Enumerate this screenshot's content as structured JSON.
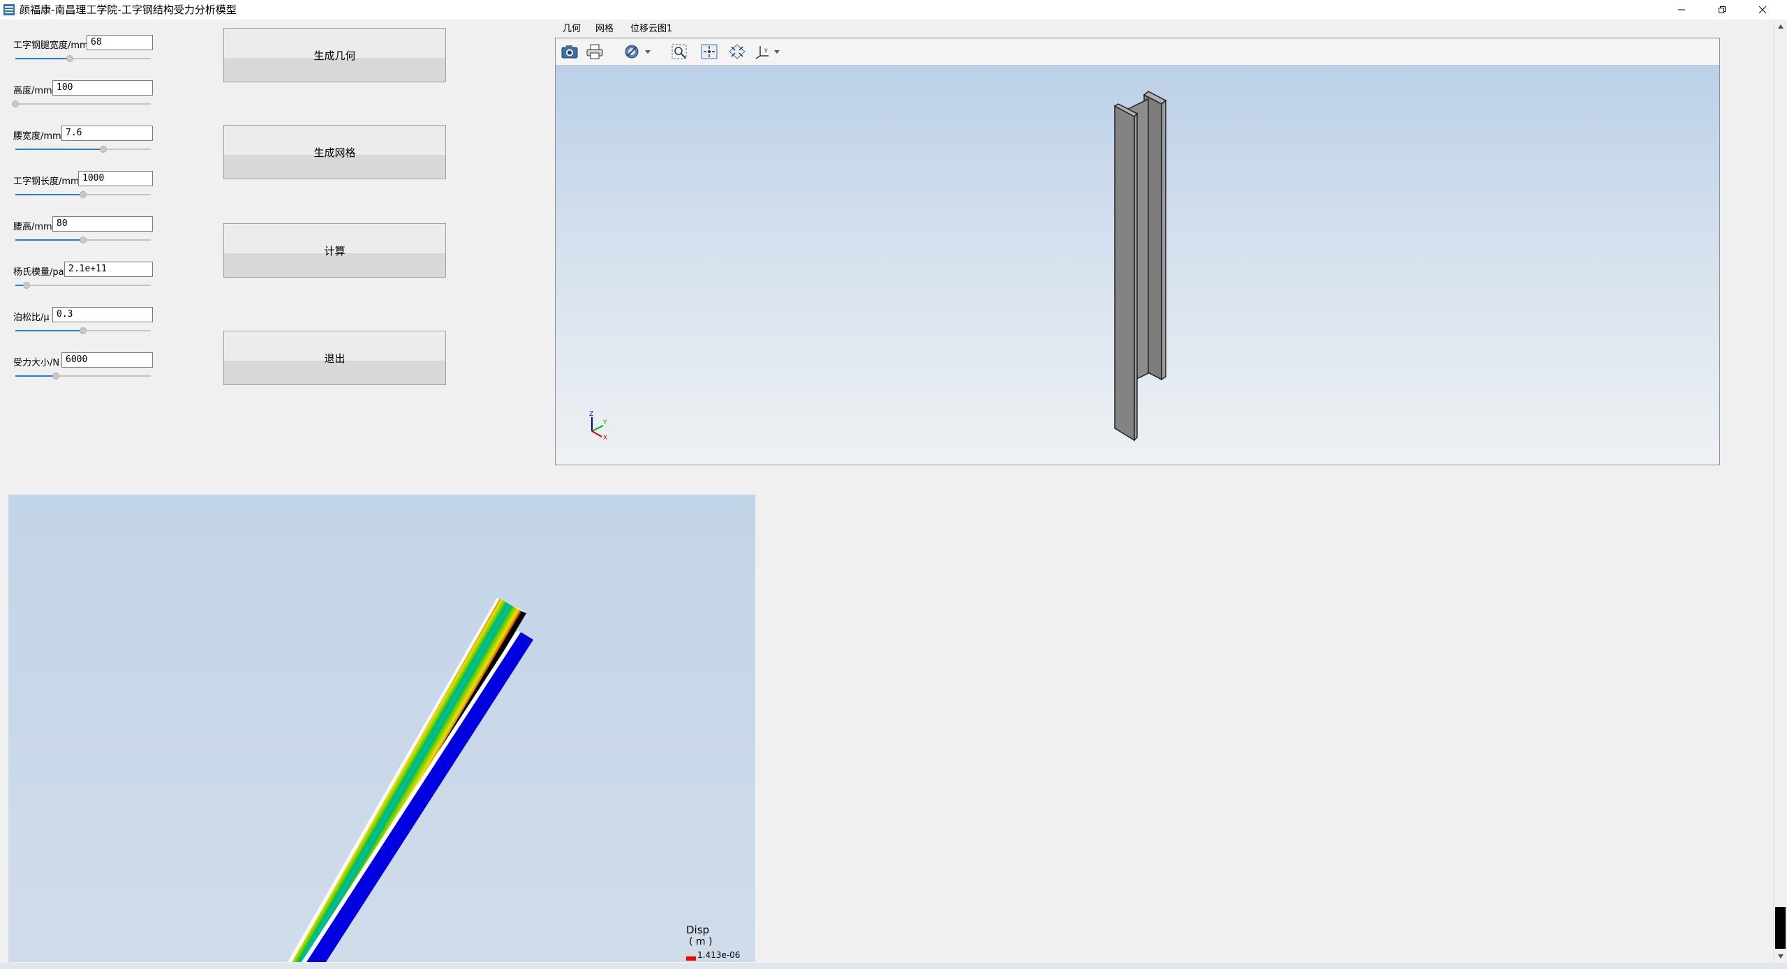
{
  "window": {
    "title": "颜福康-南昌理工学院-工字钢结构受力分析模型",
    "minimize_icon": "minimize-icon",
    "restore_icon": "restore-icon",
    "close_icon": "close-icon"
  },
  "params": [
    {
      "label": "工字钢腿宽度/mm",
      "value": "68",
      "slider": 0.4
    },
    {
      "label": "高度/mm",
      "value": "100",
      "slider": 0.0
    },
    {
      "label": "腰宽度/mm",
      "value": "7.6",
      "slider": 0.65
    },
    {
      "label": "工字钢长度/mm",
      "value": "1000",
      "slider": 0.5
    },
    {
      "label": "腰高/mm",
      "value": "80",
      "slider": 0.5
    },
    {
      "label": "杨氏模量/pa",
      "value": "2.1e+11",
      "slider": 0.08
    },
    {
      "label": "泊松比/μ",
      "value": "0.3",
      "slider": 0.5
    },
    {
      "label": "受力大小/N",
      "value": "6000",
      "slider": 0.3
    }
  ],
  "buttons": {
    "generate_geometry": "生成几何",
    "generate_mesh": "生成网格",
    "compute": "计算",
    "exit": "退出"
  },
  "view_tabs": [
    "几何",
    "网格",
    "位移云图1"
  ],
  "toolbar_icons": [
    "camera-icon",
    "print-icon",
    "display-mode-icon",
    "zoom-box-icon",
    "fit-all-icon",
    "zoom-window-icon",
    "axes-orient-icon"
  ],
  "axis_triad": {
    "z": "Z",
    "y": "Y",
    "x": "X"
  },
  "legend": {
    "title": "Disp",
    "unit": "( m )",
    "value": "1.413e-06"
  },
  "colors": {
    "slider_fill": "#2b79d0",
    "steel": "#808080",
    "disp_blue": "#0000e0",
    "legend_red": "#ff0000"
  }
}
